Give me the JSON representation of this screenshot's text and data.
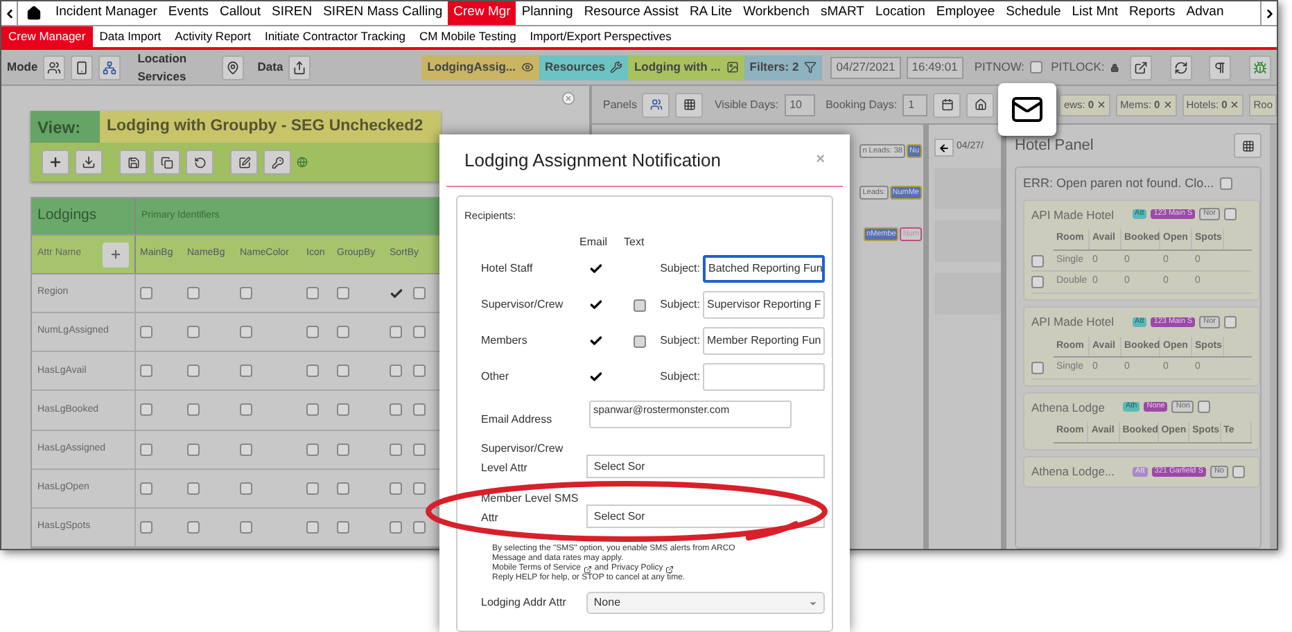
{
  "nav": {
    "items": [
      {
        "label": "Incident Manager",
        "selected": false
      },
      {
        "label": "Events",
        "selected": false
      },
      {
        "label": "Callout",
        "selected": false
      },
      {
        "label": "SIREN",
        "selected": false
      },
      {
        "label": "SIREN Mass Calling",
        "selected": false
      },
      {
        "label": "Crew Mgr",
        "selected": true
      },
      {
        "label": "Planning",
        "selected": false
      },
      {
        "label": "Resource Assist",
        "selected": false
      },
      {
        "label": "RA Lite",
        "selected": false
      },
      {
        "label": "Workbench",
        "selected": false
      },
      {
        "label": "sMART",
        "selected": false
      },
      {
        "label": "Location",
        "selected": false
      },
      {
        "label": "Employee",
        "selected": false
      },
      {
        "label": "Schedule",
        "selected": false
      },
      {
        "label": "List Mnt",
        "selected": false
      },
      {
        "label": "Reports",
        "selected": false
      },
      {
        "label": "Advan",
        "selected": false
      }
    ]
  },
  "subnav": [
    {
      "label": "Crew Manager",
      "selected": true
    },
    {
      "label": "Data Import",
      "selected": false
    },
    {
      "label": "Activity Report",
      "selected": false
    },
    {
      "label": "Initiate Contractor Tracking",
      "selected": false
    },
    {
      "label": "CM Mobile Testing",
      "selected": false
    },
    {
      "label": "Import/Export Perspectives",
      "selected": false
    }
  ],
  "toolbar": {
    "mode_label": "Mode",
    "location_label": "Location Services",
    "data_label": "Data",
    "chips": [
      {
        "label": "LodgingAssig...",
        "color": "#c9b562"
      },
      {
        "label": "Resources",
        "color": "#6cc3c3"
      },
      {
        "label": "Lodging with ...",
        "color": "#a9c25e"
      },
      {
        "label": "Filters: 2",
        "color": "#8eb2bf"
      }
    ],
    "date": "04/27/2021",
    "time": "16:49:01",
    "pitnow": {
      "label": "PITNOW:",
      "checked": false
    },
    "pitlock_label": "PITLOCK:"
  },
  "view_panel": {
    "label": "View:",
    "title": "Lodging with Groupby - SEG Unchecked2"
  },
  "lodgings_table": {
    "title": "Lodgings",
    "group": "Primary Identifiers",
    "attr_header": "Attr Name",
    "columns": [
      "MainBg",
      "NameBg",
      "NameColor",
      "Icon",
      "GroupBy",
      "SortBy"
    ],
    "rows": [
      {
        "name": "Region",
        "checks": [
          false,
          false,
          false,
          false,
          false,
          true,
          false
        ]
      },
      {
        "name": "NumLgAssigned",
        "checks": [
          false,
          false,
          false,
          false,
          false,
          false,
          false
        ]
      },
      {
        "name": "HasLgAvail",
        "checks": [
          false,
          false,
          false,
          false,
          false,
          false,
          false
        ]
      },
      {
        "name": "HasLgBooked",
        "checks": [
          false,
          false,
          false,
          false,
          false,
          false,
          false
        ]
      },
      {
        "name": "HasLgAssigned",
        "checks": [
          false,
          false,
          false,
          false,
          false,
          false,
          false
        ]
      },
      {
        "name": "HasLgOpen",
        "checks": [
          false,
          false,
          false,
          false,
          false,
          false,
          false
        ]
      },
      {
        "name": "HasLgSpots",
        "checks": [
          false,
          false,
          false,
          false,
          false,
          false,
          false
        ]
      }
    ]
  },
  "panels_bar": {
    "panels_label": "Panels",
    "visible_days_label": "Visible Days:",
    "visible_days": "10",
    "booking_days_label": "Booking Days:",
    "booking_days": "1",
    "counters": [
      {
        "label": "ews:",
        "value": "0"
      },
      {
        "label": "Mems:",
        "value": "0"
      },
      {
        "label": "Hotels:",
        "value": "0"
      },
      {
        "label": "Roo"
      }
    ]
  },
  "schedule_tags": [
    [
      {
        "text": "n Leads: 38",
        "kind": "outline"
      },
      {
        "text": "Nu",
        "kind": "blue"
      }
    ],
    [
      {
        "text": "Leads:",
        "kind": "outline"
      },
      {
        "text": "NumMe",
        "kind": "blue"
      }
    ],
    [
      {
        "text": "nMembe",
        "kind": "blue"
      },
      {
        "text": "Num",
        "kind": "pink"
      }
    ]
  ],
  "date_column": {
    "date": "04/27/"
  },
  "hotel_panel": {
    "title": "Hotel Panel",
    "error": "ERR: Open paren not found. Clo...",
    "error_checked": false,
    "hotels": [
      {
        "name": "API Made Hotel",
        "checked": false,
        "tags": [
          {
            "text": "Att",
            "kind": "teal"
          },
          {
            "text": "123 Main S",
            "kind": "purple"
          },
          {
            "text": "Nor",
            "kind": "outline"
          }
        ],
        "columns": [
          "Room",
          "Avail",
          "Booked",
          "Open",
          "Spots"
        ],
        "rooms": [
          {
            "checked": false,
            "cells": [
              "Single",
              "0",
              "0",
              "0",
              "0"
            ]
          },
          {
            "checked": false,
            "cells": [
              "Double",
              "0",
              "0",
              "0",
              "0"
            ]
          }
        ]
      },
      {
        "name": "API Made Hotel",
        "checked": false,
        "tags": [
          {
            "text": "Att",
            "kind": "teal"
          },
          {
            "text": "123 Main S",
            "kind": "purple"
          },
          {
            "text": "Nor",
            "kind": "outline"
          }
        ],
        "columns": [
          "Room",
          "Avail",
          "Booked",
          "Open",
          "Spots"
        ],
        "rooms": [
          {
            "checked": false,
            "cells": [
              "Single",
              "0",
              "0",
              "0",
              "0"
            ]
          }
        ]
      },
      {
        "name": "Athena Lodge",
        "checked": false,
        "tags": [
          {
            "text": "Ath",
            "kind": "teal"
          },
          {
            "text": "None",
            "kind": "purple"
          },
          {
            "text": "Non",
            "kind": "outline"
          }
        ],
        "columns": [
          "Room",
          "Avail",
          "Booked",
          "Open",
          "Spots",
          "Te"
        ]
      },
      {
        "name": "Athena Lodge...",
        "checked": false,
        "tags": [
          {
            "text": "Att",
            "kind": "lilac"
          },
          {
            "text": "321 Garfield S",
            "kind": "purple"
          },
          {
            "text": "No",
            "kind": "outline"
          }
        ]
      }
    ]
  },
  "modal": {
    "title": "Lodging Assignment Notification",
    "close": "×",
    "recipients_label": "Recipients:",
    "email_header": "Email",
    "text_header": "Text",
    "recipients": [
      {
        "label": "Hotel Staff",
        "email": true,
        "kind": "email_only",
        "subject_label": "Subject:",
        "subject": "Batched Reporting Fun",
        "focused": true
      },
      {
        "label": "Supervisor/Crew",
        "email": true,
        "kind": "email_text",
        "text": false,
        "subject_label": "Subject:",
        "subject": "Supervisor Reporting F",
        "focused": false
      },
      {
        "label": "Members",
        "email": true,
        "kind": "email_text",
        "text": false,
        "subject_label": "Subject:",
        "subject": "Member Reporting Fun",
        "focused": false
      },
      {
        "label": "Other",
        "email": true,
        "kind": "email_only",
        "subject_label": "Subject:",
        "focused": false
      }
    ],
    "email_label": "Email Address",
    "email_value": "spanwar@rostermonster.com",
    "supervisor_attr_label": "Supervisor/Crew Level Attr",
    "supervisor_attr_value": "Select Sor",
    "member_attr_label": "Member Level SMS Attr",
    "member_attr_value": "Select Sor",
    "disclaimer": [
      "By selecting the \"SMS\" option, you enable SMS alerts from ARCO",
      "Message and data rates may apply."
    ],
    "terms_link": "Mobile Terms of Service",
    "and_text": "and",
    "privacy_link": "Privacy Policy",
    "reply_text": "Reply HELP for help, or STOP to cancel at any time.",
    "addr_label": "Lodging Addr Attr",
    "addr_value": "None"
  }
}
